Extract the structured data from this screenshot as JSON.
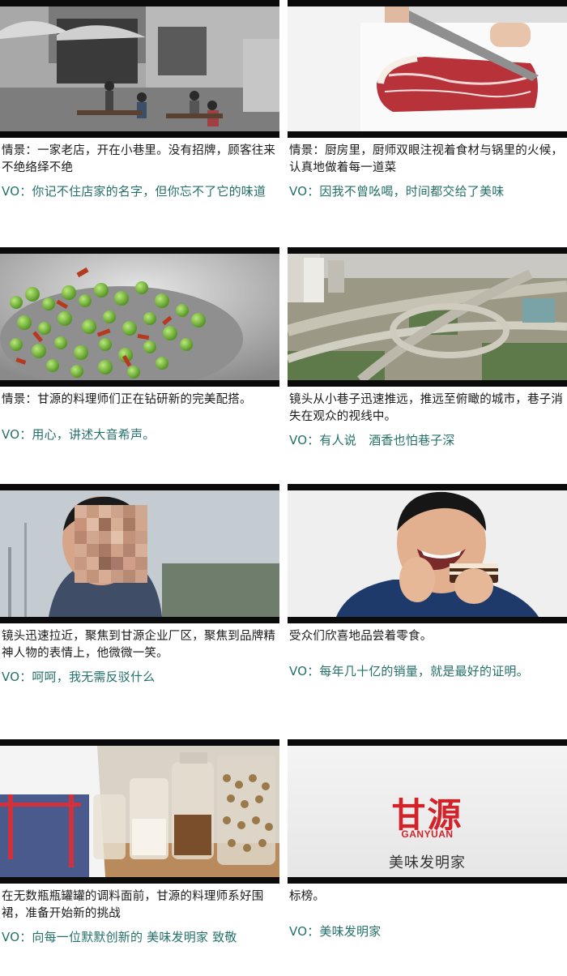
{
  "panels": [
    {
      "desc": "情景：一家老店，开在小巷里。没有招牌，顾客往来不绝络绎不绝",
      "vo": "VO：你记不住店家的名字，但你忘不了它的味道"
    },
    {
      "desc": "情景：厨房里，厨师双眼注视着食材与锅里的火候，认真地做着每一道菜",
      "vo": "VO：因我不曾吆喝，时间都交给了美味"
    },
    {
      "desc": "情景：甘源的料理师们正在钻研新的完美配搭。",
      "vo": "VO：用心，讲述大音希声。"
    },
    {
      "desc": "镜头从小巷子迅速推远，推远至俯瞰的城市，巷子消失在观众的视线中。",
      "vo": "VO：有人说　酒香也怕巷子深"
    },
    {
      "desc": "镜头迅速拉近，聚焦到甘源企业厂区，聚焦到品牌精神人物的表情上，他微微一笑。",
      "vo": "VO：呵呵，我无需反驳什么"
    },
    {
      "desc": "受众们欣喜地品尝着零食。",
      "vo": "VO：每年几十亿的销量，就是最好的证明。"
    },
    {
      "desc": "在无数瓶瓶罐罐的调料面前，甘源的料理师系好围裙，准备开始新的挑战",
      "vo": "VO：向每一位默默创新的 美味发明家 致敬"
    },
    {
      "desc": "标榜。",
      "vo": "VO：美味发明家"
    }
  ],
  "brand": {
    "logo_text": "甘源",
    "english": "GANYUAN",
    "slogan": "美味发明家"
  },
  "colors": {
    "vo_text": "#24706a",
    "desc_text": "#1a1a1a",
    "brand_red": "#d3232a",
    "letterbox": "#0b0b0b"
  }
}
